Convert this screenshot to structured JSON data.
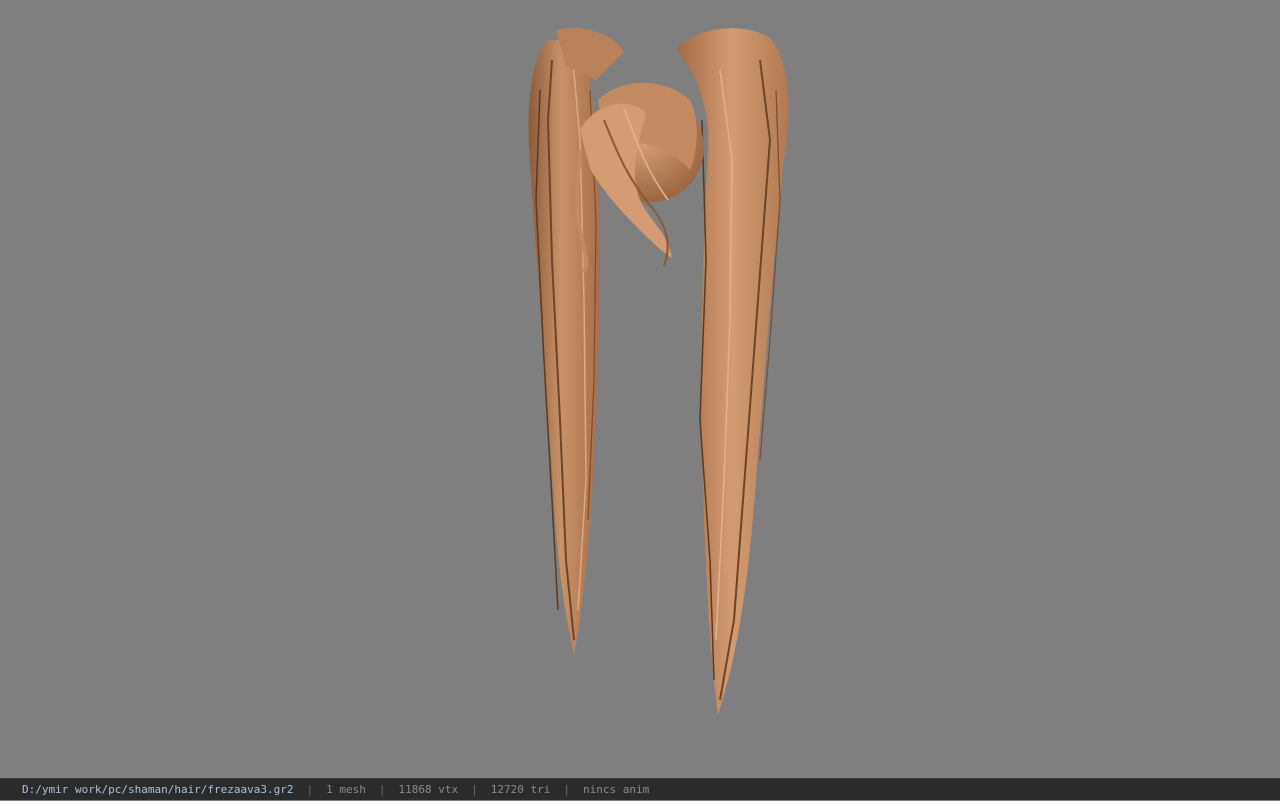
{
  "viewport": {
    "model_name": "hair-model",
    "background_color": "#7f7f7f",
    "hair_color": "#c98f67"
  },
  "statusbar": {
    "file_path": "D:/ymir work/pc/shaman/hair/frezaava3.gr2",
    "separator": "|",
    "mesh_count": "1 mesh",
    "vertex_count": "11868 vtx",
    "triangle_count": "12720 tri",
    "anim_status": "nincs anim"
  }
}
